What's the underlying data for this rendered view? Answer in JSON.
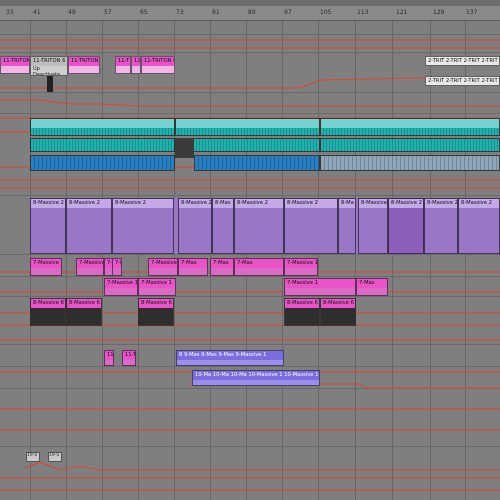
{
  "ruler": {
    "bars": [
      "33",
      "41",
      "49",
      "57",
      "65",
      "73",
      "81",
      "89",
      "97",
      "105",
      "113",
      "121",
      "129",
      "137"
    ]
  },
  "clips": {
    "triton_a": "11-TRITON 6",
    "triton_b": "11-TRITON 6",
    "triton_c": "11-TRITON",
    "triton_d": "11-T",
    "triton_e": "11-TRITON 6",
    "triton_f": "11-TRITON 6",
    "deactivate": "Up Deactivate",
    "trit_right": [
      "2-TRIT",
      "2-TRIT",
      "2-TRIT",
      "2-TRIT"
    ],
    "trit_right2": [
      "2-TRIT",
      "2-TRIT",
      "2-TRIT",
      "2-TRIT"
    ],
    "massive2": [
      "8-Massive 2",
      "8-Massive 2",
      "8-Massive 2",
      "8-Massive 2",
      "8-Mas",
      "8-Massive 2",
      "8-Massive 2",
      "8-Ma",
      "8-Massive 2",
      "8-Massive 2",
      "8-Massive 2",
      "8-Massive 2"
    ],
    "massive1_pink": [
      "7-Massive 1",
      "7-Massive 1",
      "7-M",
      "7-M",
      "7-Massive 1",
      "7-Mas",
      "7-Mas",
      "7-Mas",
      "7-Massive 1"
    ],
    "massive1_orange": [
      "7-Massive 1",
      "7-Massive 1",
      "7-Massive 1",
      "7-Mas"
    ],
    "massive6": [
      "8-Massive 6",
      "8-Massive 6",
      "8-Massive 6",
      "8-Massive 6",
      "8-Massive 6"
    ],
    "small_pink": [
      "11-1",
      "11-T"
    ],
    "massive9": [
      "8 9-Mas",
      "9-Mas",
      "9-Mas",
      "9-Massive 1"
    ],
    "massive10": [
      "10-Ma",
      "10-Ma",
      "10-Ma",
      "10-Massive 1",
      "10-Massive 1"
    ],
    "bottom_small": [
      "19-S",
      "19-S"
    ]
  },
  "colors": {
    "teal": "#1fb3b0",
    "blue": "#2a7fc4",
    "purple": "#9a76c6",
    "pink": "#ea52c8",
    "automation": "#e2432e",
    "indigo": "#7a6de0"
  }
}
